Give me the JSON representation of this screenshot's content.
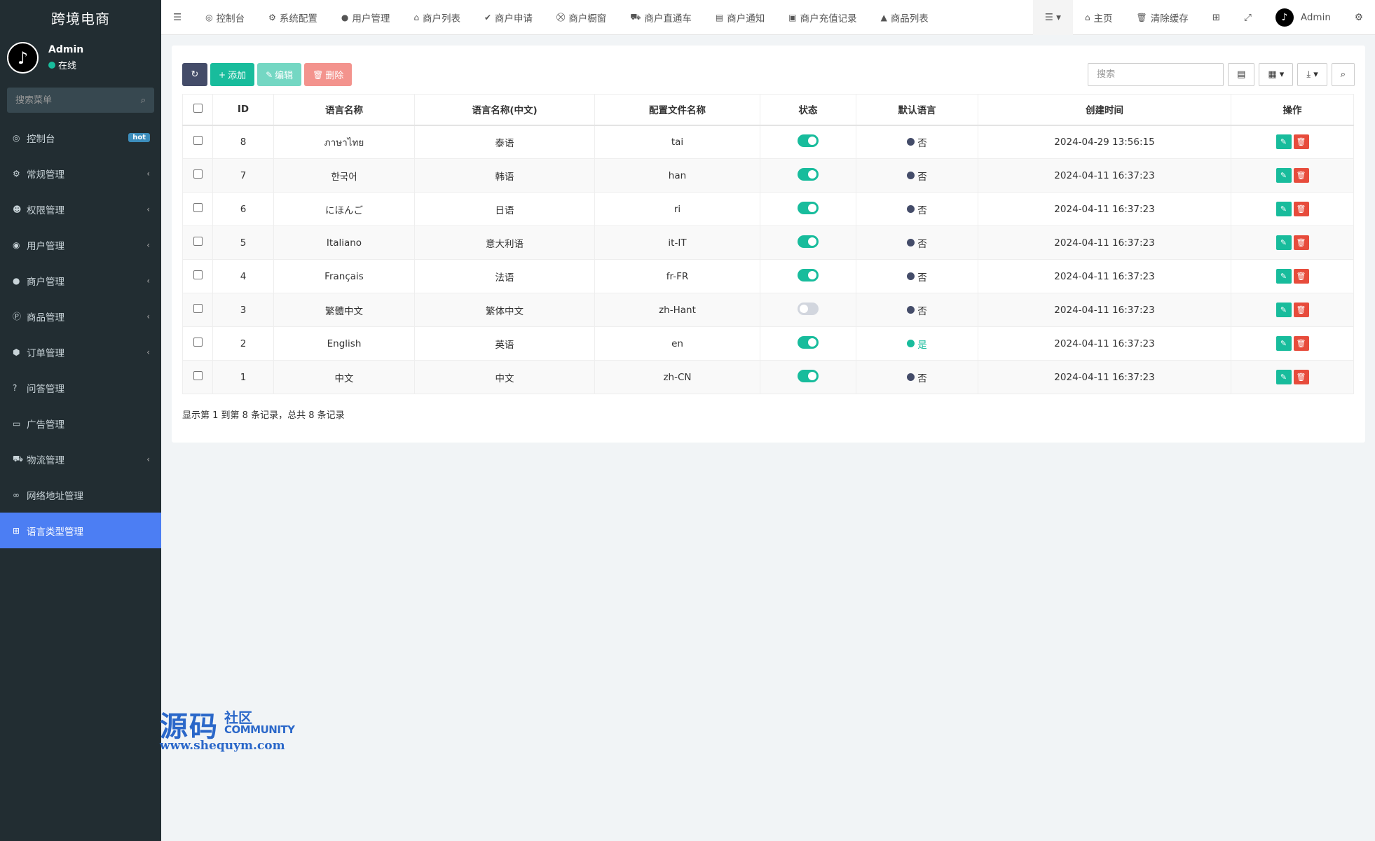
{
  "app": {
    "title": "跨境电商"
  },
  "user": {
    "name": "Admin",
    "status": "在线",
    "avatar_glyph": "♪"
  },
  "sidebar": {
    "search_placeholder": "搜索菜单",
    "items": [
      {
        "label": "控制台",
        "icon": "dashboard-icon",
        "glyph": "◎",
        "badge": "hot"
      },
      {
        "label": "常规管理",
        "icon": "cogs-icon",
        "glyph": "⚙",
        "chevron": "‹"
      },
      {
        "label": "权限管理",
        "icon": "group-icon",
        "glyph": "☻",
        "chevron": "‹"
      },
      {
        "label": "用户管理",
        "icon": "user-circle-icon",
        "glyph": "◉",
        "chevron": "‹"
      },
      {
        "label": "商户管理",
        "icon": "apple-icon",
        "glyph": "●",
        "chevron": "‹"
      },
      {
        "label": "商品管理",
        "icon": "product-hunt-icon",
        "glyph": "Ⓟ",
        "chevron": "‹"
      },
      {
        "label": "订单管理",
        "icon": "cube-icon",
        "glyph": "⬢",
        "chevron": "‹"
      },
      {
        "label": "问答管理",
        "icon": "question-circle-icon",
        "glyph": "?"
      },
      {
        "label": "广告管理",
        "icon": "credit-card-icon",
        "glyph": "▭"
      },
      {
        "label": "物流管理",
        "icon": "truck-icon",
        "glyph": "⛟",
        "chevron": "‹"
      },
      {
        "label": "网络地址管理",
        "icon": "link-icon",
        "glyph": "∞"
      },
      {
        "label": "语言类型管理",
        "icon": "language-icon",
        "glyph": "⊞",
        "active": true
      }
    ]
  },
  "header": {
    "tabs": [
      {
        "label": "控制台",
        "icon": "dashboard-icon",
        "glyph": "◎"
      },
      {
        "label": "系统配置",
        "icon": "cog-icon",
        "glyph": "⚙"
      },
      {
        "label": "用户管理",
        "icon": "user-icon",
        "glyph": "●"
      },
      {
        "label": "商户列表",
        "icon": "home-icon",
        "glyph": "⌂"
      },
      {
        "label": "商户申请",
        "icon": "check-circle-icon",
        "glyph": "✔"
      },
      {
        "label": "商户橱窗",
        "icon": "cart-icon",
        "glyph": "⛒"
      },
      {
        "label": "商户直通车",
        "icon": "car-icon",
        "glyph": "⛟"
      },
      {
        "label": "商户通知",
        "icon": "list-alt-icon",
        "glyph": "▤"
      },
      {
        "label": "商户充值记录",
        "icon": "money-icon",
        "glyph": "▣"
      },
      {
        "label": "商品列表",
        "icon": "shopping-bag-icon",
        "glyph": "▲"
      }
    ],
    "right": {
      "home": "主页",
      "clear_cache": "清除缓存",
      "admin": "Admin"
    }
  },
  "toolbar": {
    "add": "添加",
    "edit": "编辑",
    "delete": "删除",
    "search_placeholder": "搜索"
  },
  "table": {
    "columns": [
      "ID",
      "语言名称",
      "语言名称(中文)",
      "配置文件名称",
      "状态",
      "默认语言",
      "创建时间",
      "操作"
    ],
    "rows": [
      {
        "id": "8",
        "name": "ภาษาไทย",
        "name_cn": "泰语",
        "file": "tai",
        "status": "on",
        "default": "否",
        "created": "2024-04-29 13:56:15"
      },
      {
        "id": "7",
        "name": "한국어",
        "name_cn": "韩语",
        "file": "han",
        "status": "on",
        "default": "否",
        "created": "2024-04-11 16:37:23"
      },
      {
        "id": "6",
        "name": "にほんご",
        "name_cn": "日语",
        "file": "ri",
        "status": "on",
        "default": "否",
        "created": "2024-04-11 16:37:23"
      },
      {
        "id": "5",
        "name": "Italiano",
        "name_cn": "意大利语",
        "file": "it-IT",
        "status": "on",
        "default": "否",
        "created": "2024-04-11 16:37:23"
      },
      {
        "id": "4",
        "name": "Français",
        "name_cn": "法语",
        "file": "fr-FR",
        "status": "on",
        "default": "否",
        "created": "2024-04-11 16:37:23"
      },
      {
        "id": "3",
        "name": "繁體中文",
        "name_cn": "繁体中文",
        "file": "zh-Hant",
        "status": "off",
        "default": "否",
        "created": "2024-04-11 16:37:23"
      },
      {
        "id": "2",
        "name": "English",
        "name_cn": "英语",
        "file": "en",
        "status": "on",
        "default": "是",
        "created": "2024-04-11 16:37:23"
      },
      {
        "id": "1",
        "name": "中文",
        "name_cn": "中文",
        "file": "zh-CN",
        "status": "on",
        "default": "否",
        "created": "2024-04-11 16:37:23"
      }
    ]
  },
  "pagination": {
    "info": "显示第 1 到第 8 条记录，总共 8 条记录"
  },
  "watermark": {
    "big": "源码",
    "small": "社区",
    "community": "COMMUNITY",
    "url": "www.shequym.com"
  },
  "colors": {
    "sidebar": "#222d32",
    "active": "#4c7ef3",
    "success": "#18bc9c",
    "danger": "#e74c3c",
    "primary_dark": "#444c69"
  }
}
